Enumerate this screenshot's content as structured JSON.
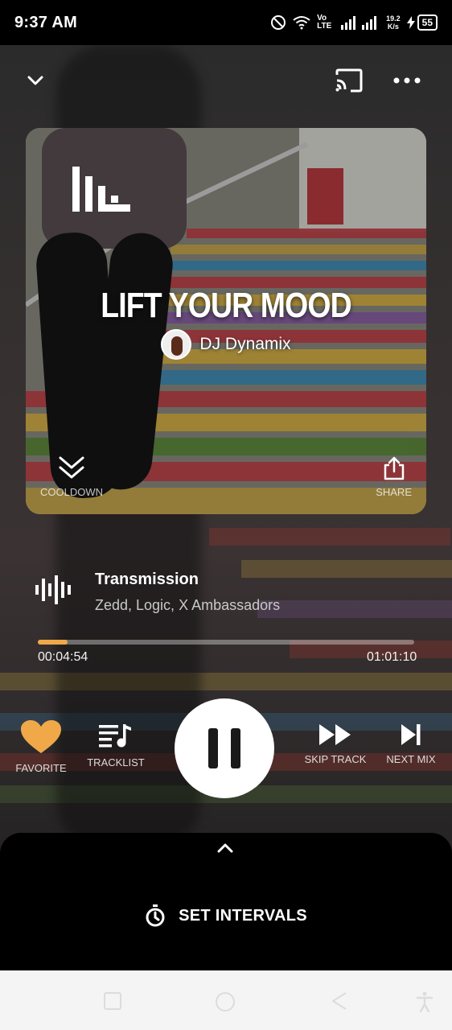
{
  "status_bar": {
    "time": "9:37 AM",
    "network": "Vo LTE",
    "speed_value": "19.2",
    "speed_unit": "K/s",
    "battery": "55"
  },
  "cover": {
    "title": "LIFT YOUR MOOD",
    "artist": "DJ Dynamix",
    "cooldown_label": "COOLDOWN",
    "share_label": "SHARE"
  },
  "track": {
    "title": "Transmission",
    "artists": "Zedd, Logic, X Ambassadors",
    "elapsed": "00:04:54",
    "total": "01:01:10",
    "progress": 0.08
  },
  "controls": {
    "favorite_label": "FAVORITE",
    "tracklist_label": "TRACKLIST",
    "skip_label": "SKIP TRACK",
    "next_label": "NEXT MIX"
  },
  "sheet": {
    "intervals_label": "SET INTERVALS"
  },
  "colors": {
    "accent": "#f0a848",
    "background": "#2e2a2b"
  },
  "icons": [
    "chevron-down-icon",
    "cast-icon",
    "more-icon",
    "app-logo-icon",
    "cooldown-icon",
    "share-icon",
    "waveform-icon",
    "heart-icon",
    "tracklist-icon",
    "pause-icon",
    "skip-icon",
    "next-icon",
    "chevron-up-icon",
    "stopwatch-icon"
  ]
}
